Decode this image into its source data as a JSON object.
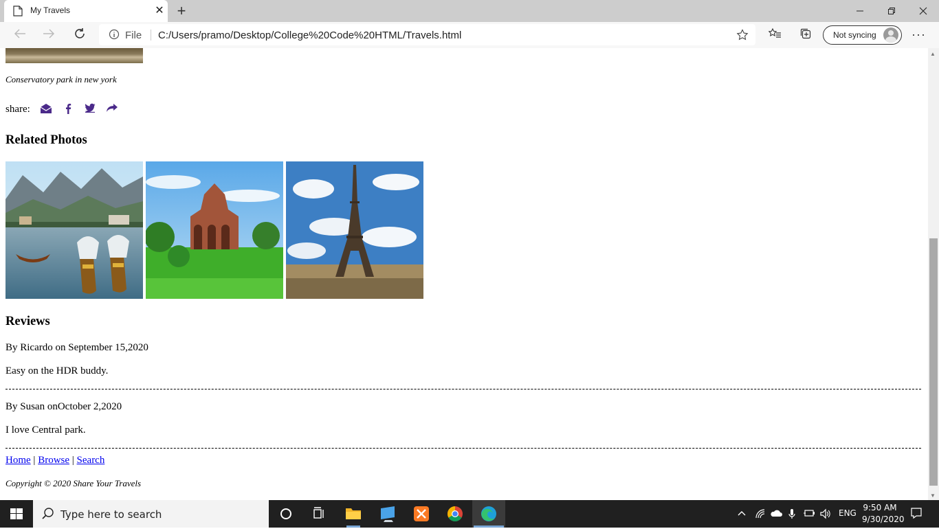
{
  "browser": {
    "tab_title": "My Travels",
    "tab_close": "✕",
    "new_tab": "+",
    "protocol": "File",
    "url": "C:/Users/pramo/Desktop/College%20Code%20HTML/Travels.html",
    "sync_label": "Not syncing",
    "more_label": "···"
  },
  "page": {
    "caption": "Conservatory park in new york",
    "share_label": "share:",
    "related_heading": "Related Photos",
    "reviews_heading": "Reviews",
    "reviews": [
      {
        "byline": "By Ricardo on September 15,2020",
        "text": "Easy on the HDR buddy."
      },
      {
        "byline": "By Susan onOctober 2,2020",
        "text": "I love Central park."
      }
    ],
    "footer_links": [
      "Home",
      "Browse",
      "Search"
    ],
    "footer_sep": "|",
    "copyright": "Copyright © 2020 Share Your Travels"
  },
  "taskbar": {
    "search_placeholder": "Type here to search",
    "language": "ENG",
    "time": "9:50 AM",
    "date": "9/30/2020"
  },
  "colors": {
    "link": "#0000ee",
    "share_icon": "#4b2a8a",
    "taskbar": "#202020",
    "tabbar": "#cdcdcd"
  }
}
